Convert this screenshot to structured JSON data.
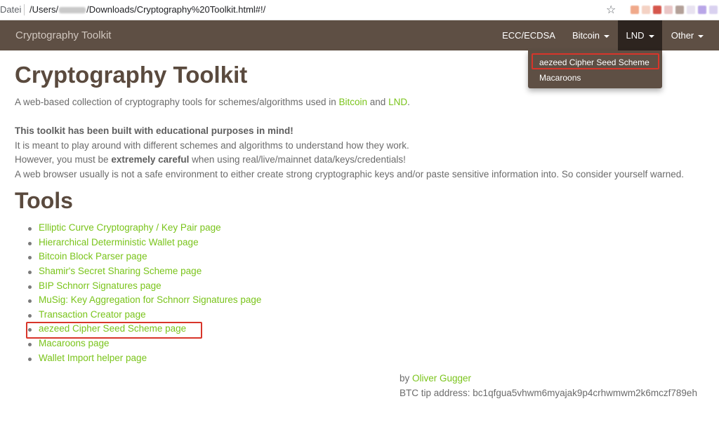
{
  "browser": {
    "url_prefix": "Datei",
    "url_part1": "/Users/",
    "url_part2": "/Downloads/Cryptography%20Toolkit.html#!/",
    "star_icon": "star-icon"
  },
  "navbar": {
    "brand": "Cryptography Toolkit",
    "items": [
      {
        "label": "ECC/ECDSA"
      },
      {
        "label": "Bitcoin"
      },
      {
        "label": "LND"
      },
      {
        "label": "Other"
      }
    ],
    "dropdown": [
      {
        "label": "aezeed Cipher Seed Scheme"
      },
      {
        "label": "Macaroons"
      }
    ]
  },
  "intro": {
    "title": "Cryptography Toolkit",
    "desc_before": "A web-based collection of cryptography tools for schemes/algorithms used in ",
    "bitcoin_link": "Bitcoin",
    "desc_and": " and ",
    "lnd_link": "LND",
    "desc_end": ".",
    "edu_bold": "This toolkit has been built with educational purposes in mind!",
    "line2": "It is meant to play around with different schemes and algorithms to understand how they work.",
    "line3_before": "However, you must be ",
    "line3_bold": "extremely careful",
    "line3_after": " when using real/live/mainnet data/keys/credentials!",
    "line4": "A web browser usually is not a safe environment to either create strong cryptographic keys and/or paste sensitive information into. So consider yourself warned."
  },
  "tools": {
    "title": "Tools",
    "items": [
      "Elliptic Curve Cryptography / Key Pair page",
      "Hierarchical Deterministic Wallet page",
      "Bitcoin Block Parser page",
      "Shamir's Secret Sharing Scheme page",
      "BIP Schnorr Signatures page",
      "MuSig: Key Aggregation for Schnorr Signatures page",
      "Transaction Creator page",
      "aezeed Cipher Seed Scheme page",
      "Macaroons page",
      "Wallet Import helper page"
    ]
  },
  "footer": {
    "by": "by ",
    "author": "Oliver Gugger",
    "tip_label": "BTC tip address: ",
    "tip_address": "bc1qfgua5vhwm6myajak9p4crhwmwm2k6mczf789eh"
  },
  "colors": {
    "navbar": "#5e4f44",
    "active": "#2d241f",
    "link": "#7ac41b",
    "highlight": "#d8352a"
  }
}
